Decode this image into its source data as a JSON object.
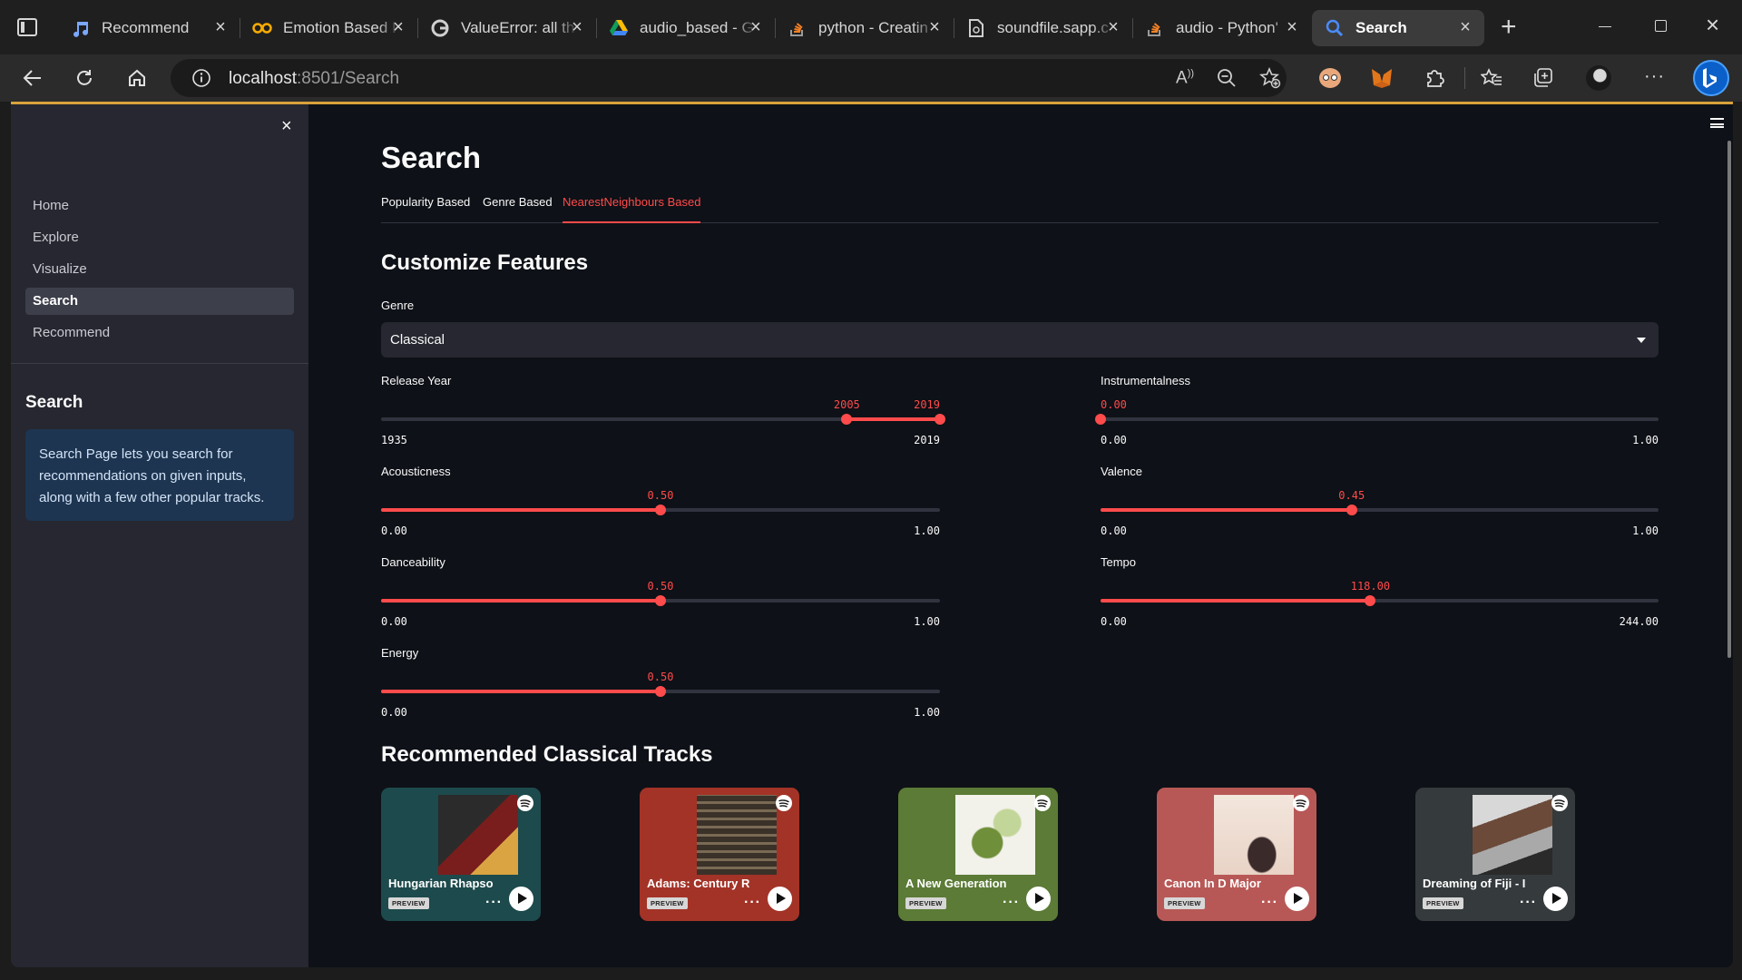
{
  "browser": {
    "tabs": [
      {
        "label": "Recommend",
        "icon": "music-icon",
        "active": false
      },
      {
        "label": "Emotion Based I",
        "icon": "colab-icon",
        "active": false
      },
      {
        "label": "ValueError: all th",
        "icon": "google-icon",
        "active": false
      },
      {
        "label": "audio_based - G",
        "icon": "drive-icon",
        "active": false
      },
      {
        "label": "python - Creatin",
        "icon": "stackoverflow-icon",
        "active": false
      },
      {
        "label": "soundfile.sapp.c",
        "icon": "doc-icon",
        "active": false
      },
      {
        "label": "audio - Python'",
        "icon": "stackoverflow-icon",
        "active": false
      },
      {
        "label": "Search",
        "icon": "search-icon",
        "active": true
      }
    ],
    "url_host": "localhost",
    "url_path": ":8501/Search"
  },
  "sidebar": {
    "nav": [
      {
        "label": "Home",
        "active": false
      },
      {
        "label": "Explore",
        "active": false
      },
      {
        "label": "Visualize",
        "active": false
      },
      {
        "label": "Search",
        "active": true
      },
      {
        "label": "Recommend",
        "active": false
      }
    ],
    "heading": "Search",
    "info": "Search Page lets you search for recommendations on given inputs, along with a few other popular tracks."
  },
  "main": {
    "title": "Search",
    "tabs": [
      {
        "label": "Popularity Based",
        "active": false
      },
      {
        "label": "Genre Based",
        "active": false
      },
      {
        "label": "NearestNeighbours Based",
        "active": true
      }
    ],
    "section_title": "Customize Features",
    "genre_label": "Genre",
    "genre_value": "Classical",
    "sliders": {
      "release_year": {
        "label": "Release Year",
        "min": 1935,
        "max": 2019,
        "low": 2005,
        "high": 2019,
        "min_text": "1935",
        "max_text": "2019",
        "low_text": "2005",
        "high_text": "2019"
      },
      "instrumentalness": {
        "label": "Instrumentalness",
        "min": 0,
        "max": 1,
        "value": 0.0,
        "min_text": "0.00",
        "max_text": "1.00",
        "value_text": "0.00"
      },
      "acousticness": {
        "label": "Acousticness",
        "min": 0,
        "max": 1,
        "value": 0.5,
        "min_text": "0.00",
        "max_text": "1.00",
        "value_text": "0.50"
      },
      "valence": {
        "label": "Valence",
        "min": 0,
        "max": 1,
        "value": 0.45,
        "min_text": "0.00",
        "max_text": "1.00",
        "value_text": "0.45"
      },
      "danceability": {
        "label": "Danceability",
        "min": 0,
        "max": 1,
        "value": 0.5,
        "min_text": "0.00",
        "max_text": "1.00",
        "value_text": "0.50"
      },
      "tempo": {
        "label": "Tempo",
        "min": 0,
        "max": 244,
        "value": 118,
        "min_text": "0.00",
        "max_text": "244.00",
        "value_text": "118.00"
      },
      "energy": {
        "label": "Energy",
        "min": 0,
        "max": 1,
        "value": 0.5,
        "min_text": "0.00",
        "max_text": "1.00",
        "value_text": "0.50"
      }
    },
    "tracks_title": "Recommended Classical Tracks",
    "tracks": [
      {
        "title": "Hungarian Rhapso",
        "badge": "PREVIEW",
        "color": "#1d4a4c"
      },
      {
        "title": "Adams: Century R",
        "badge": "PREVIEW",
        "color": "#a33327"
      },
      {
        "title": "A New Generation",
        "badge": "PREVIEW",
        "color": "#5b7b36"
      },
      {
        "title": "Canon In D Major",
        "badge": "PREVIEW",
        "color": "#b85856"
      },
      {
        "title": "Dreaming of Fiji - I",
        "badge": "PREVIEW",
        "color": "#353a3c"
      }
    ]
  }
}
